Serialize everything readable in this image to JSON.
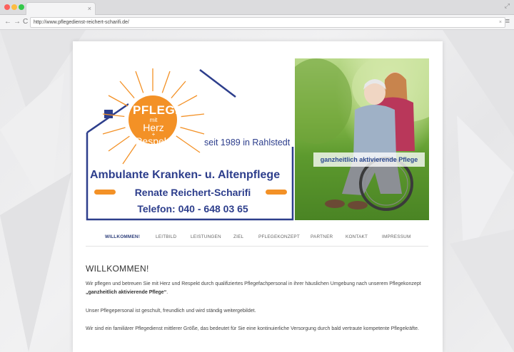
{
  "browser": {
    "url": "http://www.pflegedienst-reichert-scharifi.de/",
    "tab_close": "×",
    "back": "←",
    "forward": "→",
    "reload": "C",
    "menu": "≡",
    "clear": "×",
    "expand": "⤢"
  },
  "logo": {
    "word1": "PFLEGE",
    "word2": "mit",
    "word3": "Herz",
    "word4": "+",
    "word5": "Respekt",
    "since": "seit 1989 in Rahlstedt",
    "line1": "Ambulante Kranken- u. Altenpflege",
    "line2": "Renate Reichert-Scharifi",
    "line3": "Telefon: 040 - 648 03 65",
    "colors": {
      "orange": "#f39126",
      "blue": "#2d3e8c"
    }
  },
  "photo": {
    "caption": "ganzheitlich aktivierende Pflege"
  },
  "nav": {
    "items": [
      {
        "label": "WILLKOMMEN!"
      },
      {
        "label": "LEITBILD"
      },
      {
        "label": "LEISTUNGEN"
      },
      {
        "label": "ZIEL"
      },
      {
        "label": "PFLEGEKONZEPT"
      },
      {
        "label": "PARTNER"
      },
      {
        "label": "KONTAKT"
      },
      {
        "label": "IMPRESSUM"
      }
    ]
  },
  "content": {
    "heading": "WILLKOMMEN!",
    "p1_a": "Wir pflegen und betreuen Sie mit Herz und Respekt durch qualifiziertes Pflegefachpersonal in ihrer häuslichen Umgebung nach unserem Pflegekonzept ",
    "p1_b": "„ganzheitlich aktivierende Pflege“",
    "p1_c": ".",
    "p2": "Unser Pflegepersonal ist geschult, freundlich und wird ständig weitergebildet.",
    "p3": "Wir sind ein familiärer Pflegedienst mittlerer Größe, das bedeutet für Sie eine kontinuierliche Versorgung durch bald vertraute kompetente Pflegekräfte."
  }
}
